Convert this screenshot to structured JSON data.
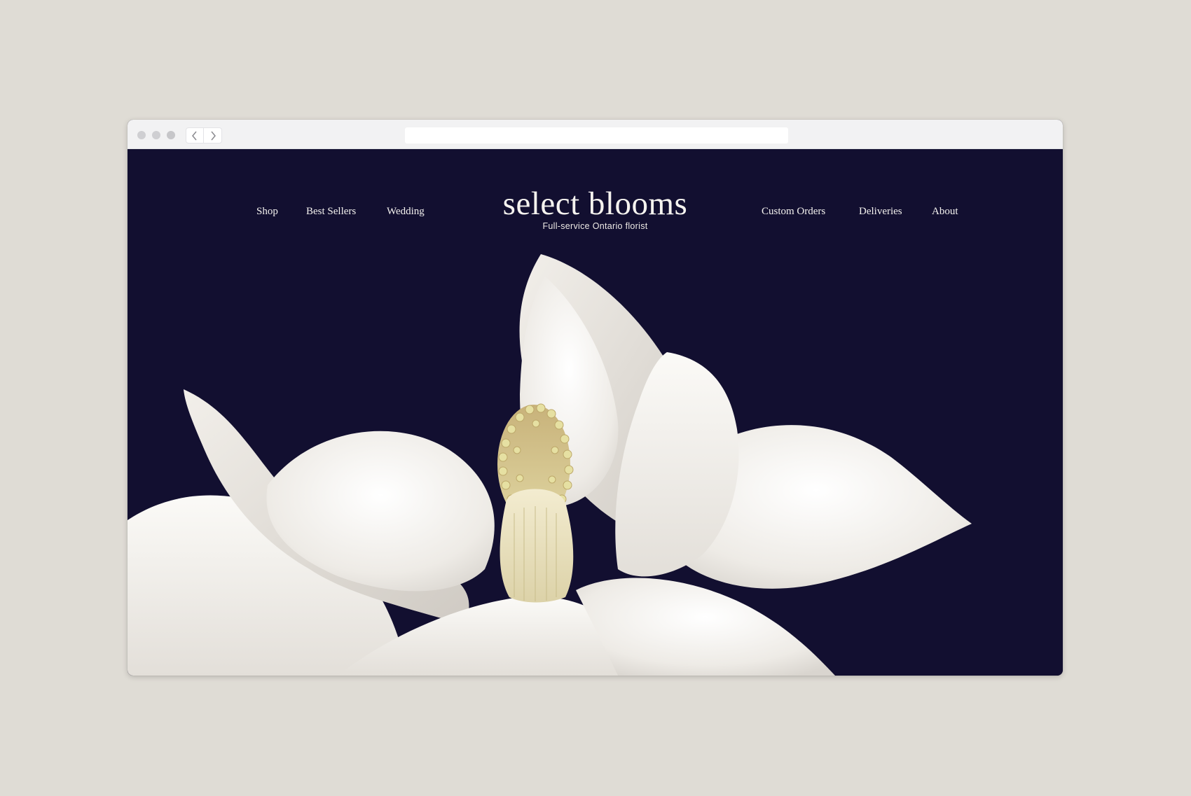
{
  "browser": {
    "back_icon": "chevron-left-icon",
    "forward_icon": "chevron-right-icon"
  },
  "site": {
    "logo": "select blooms",
    "tagline": "Full-service Ontario florist",
    "nav_left": [
      "Shop",
      "Best Sellers",
      "Wedding"
    ],
    "nav_right": [
      "Custom Orders",
      "Deliveries",
      "About"
    ]
  },
  "colors": {
    "page_background": "#dfdcd5",
    "site_background": "#120f30",
    "petal": "#f4f1ec",
    "stamen": "#e2dc98",
    "nav_text": "#f4f2ef"
  }
}
